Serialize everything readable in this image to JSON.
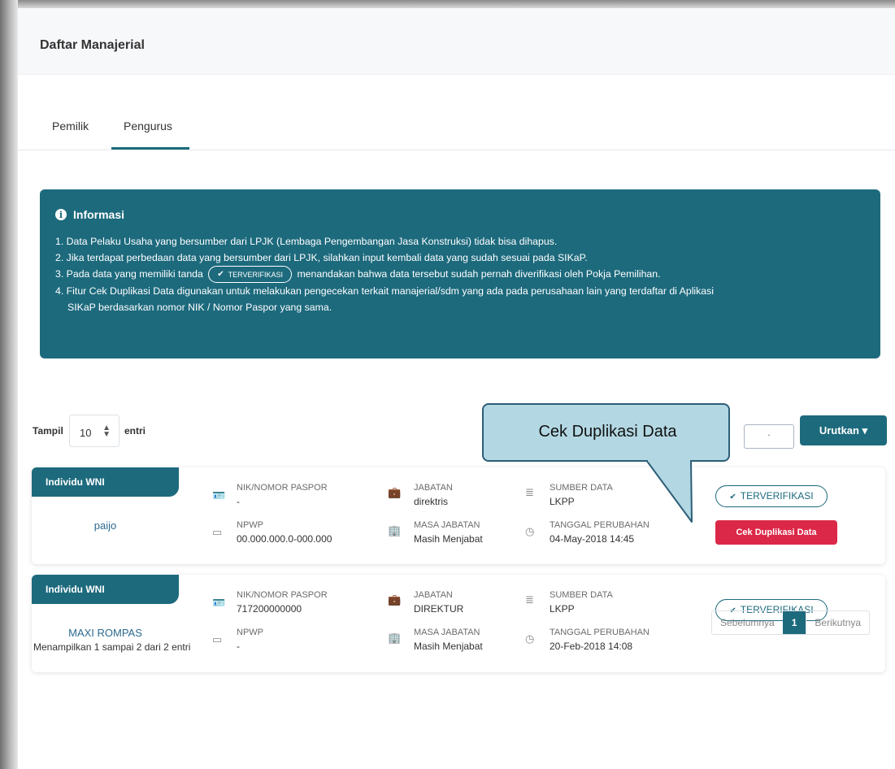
{
  "page": {
    "title": "Daftar Manajerial"
  },
  "tabs": [
    {
      "label": "Pemilik"
    },
    {
      "label": "Pengurus"
    }
  ],
  "info": {
    "title": "Informasi",
    "items": [
      "1. Data Pelaku Usaha yang bersumber dari LPJK (Lembaga Pengembangan Jasa Konstruksi) tidak bisa dihapus.",
      "2. Jika terdapat perbedaan data yang bersumber dari LPJK, silahkan input kembali data yang sudah sesuai pada SIKaP.",
      "3. Pada data yang memiliki tanda",
      "menandakan bahwa data tersebut sudah pernah diverifikasi oleh Pokja Pemilihan.",
      "4. Fitur Cek Duplikasi Data digunakan untuk melakukan pengecekan terkait manajerial/sdm yang ada pada perusahaan lain yang terdaftar di Aplikasi",
      "SIKaP berdasarkan nomor NIK / Nomor Paspor yang sama."
    ],
    "badge_label": "TERVERIFIKASI"
  },
  "controls": {
    "show_label": "Tampil",
    "page_size": "10",
    "entries_label": "entri",
    "search_value": "·",
    "sort_label": "Urutkan ▾"
  },
  "labels": {
    "nik": "NIK/NOMOR PASPOR",
    "npwp": "NPWP",
    "jabatan": "JABATAN",
    "masa_jabatan": "MASA JABATAN",
    "sumber_data": "SUMBER DATA",
    "tanggal_perubahan": "TANGGAL PERUBAHAN",
    "verified": "TERVERIFIKASI",
    "duplicate_check": "Cek Duplikasi Data"
  },
  "records": [
    {
      "type": "Individu WNI",
      "name": "paijo",
      "nik": "-",
      "npwp": "00.000.000.0-000.000",
      "jabatan": "direktris",
      "masa_jabatan": "Masih Menjabat",
      "sumber_data": "LKPP",
      "tanggal_perubahan": "04-May-2018 14:45"
    },
    {
      "type": "Individu WNI",
      "name": "MAXI ROMPAS",
      "nik": "717200000000",
      "npwp": "-",
      "jabatan": "DIREKTUR",
      "masa_jabatan": "Masih Menjabat",
      "sumber_data": "LKPP",
      "tanggal_perubahan": "20-Feb-2018 14:08"
    }
  ],
  "footer": {
    "summary": "Menampilkan 1 sampai 2 dari 2 entri",
    "prev": "Sebelumnya",
    "page": "1",
    "next": "Berikutnya"
  },
  "callout": {
    "text": "Cek Duplikasi Data"
  },
  "colors": {
    "primary": "#1d6a7d",
    "danger": "#dc2848",
    "callout_bg": "#b3d8e3"
  }
}
